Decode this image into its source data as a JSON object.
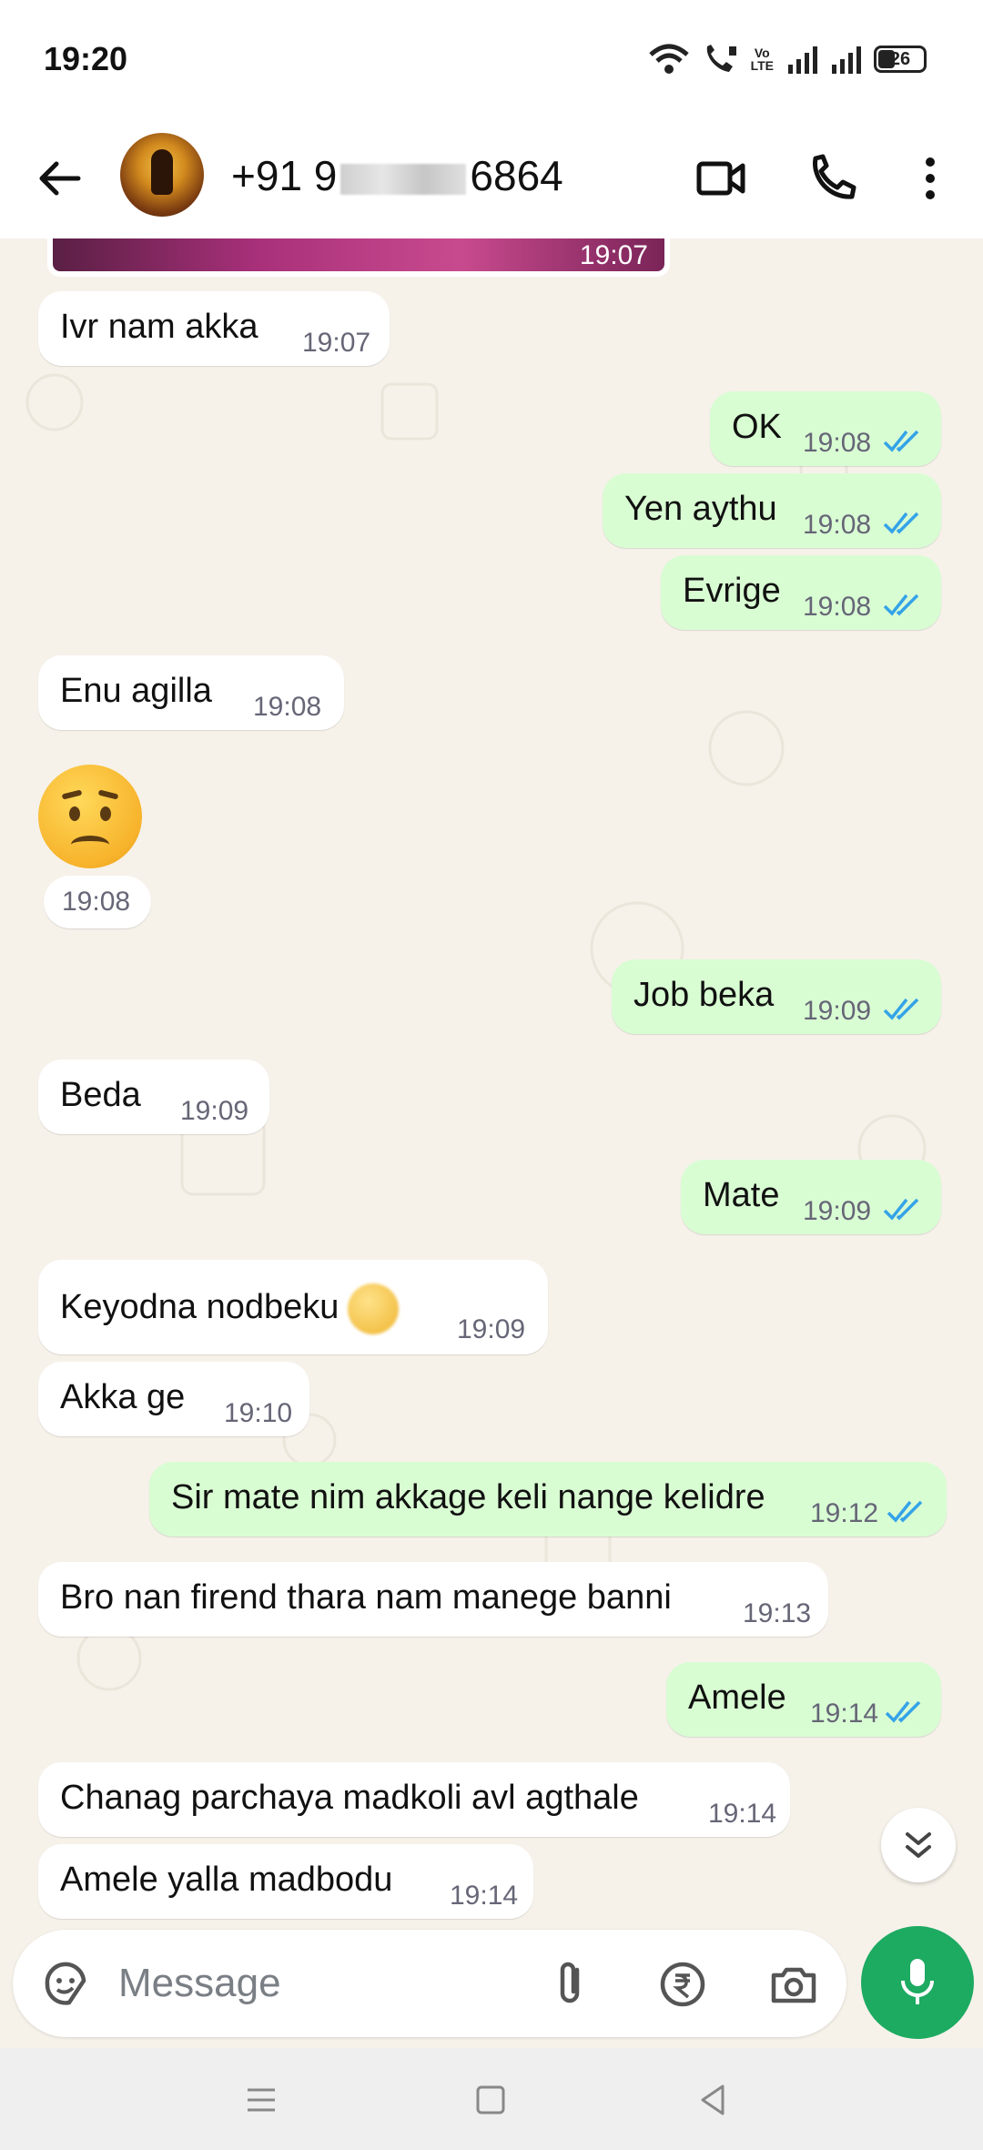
{
  "status_bar": {
    "time": "19:20",
    "volte_top": "Vo",
    "volte_bottom": "LTE",
    "battery": "26"
  },
  "header": {
    "contact_prefix": "+91 9",
    "contact_suffix": "6864"
  },
  "chat": {
    "image_time": "19:07",
    "messages": [
      {
        "dir": "in",
        "text": "Ivr nam akka",
        "time": "19:07"
      },
      {
        "dir": "out",
        "text": "OK",
        "time": "19:08"
      },
      {
        "dir": "out",
        "text": "Yen aythu",
        "time": "19:08"
      },
      {
        "dir": "out",
        "text": "Evrige",
        "time": "19:08"
      },
      {
        "dir": "in",
        "text": "Enu agilla",
        "time": "19:08"
      },
      {
        "dir": "in",
        "text": "",
        "time": "19:08"
      },
      {
        "dir": "out",
        "text": "Job beka",
        "time": "19:09"
      },
      {
        "dir": "in",
        "text": "Beda",
        "time": "19:09"
      },
      {
        "dir": "out",
        "text": "Mate",
        "time": "19:09"
      },
      {
        "dir": "in",
        "text": "Keyodna nodbeku",
        "time": "19:09"
      },
      {
        "dir": "in",
        "text": "Akka ge",
        "time": "19:10"
      },
      {
        "dir": "out",
        "text": "Sir mate nim akkage keli nange kelidre",
        "time": "19:12"
      },
      {
        "dir": "in",
        "text": "Bro nan firend thara nam manege banni",
        "time": "19:13"
      },
      {
        "dir": "out",
        "text": "Amele",
        "time": "19:14"
      },
      {
        "dir": "in",
        "text": "Chanag parchaya madkoli avl agthale",
        "time": "19:14"
      },
      {
        "dir": "in",
        "text": "Amele yalla madbodu",
        "time": "19:14"
      }
    ]
  },
  "composer": {
    "placeholder": "Message"
  },
  "colors": {
    "outgoing_bubble": "#d9fdd3",
    "incoming_bubble": "#ffffff",
    "chat_background": "#f6f2ea",
    "read_ticks": "#34a3e8",
    "mic_button": "#1daa61"
  },
  "icons": [
    "back-arrow-icon",
    "video-call-icon",
    "phone-icon",
    "more-vert-icon",
    "sticker-icon",
    "attach-icon",
    "rupee-icon",
    "camera-icon",
    "mic-icon",
    "scroll-down-icon"
  ]
}
